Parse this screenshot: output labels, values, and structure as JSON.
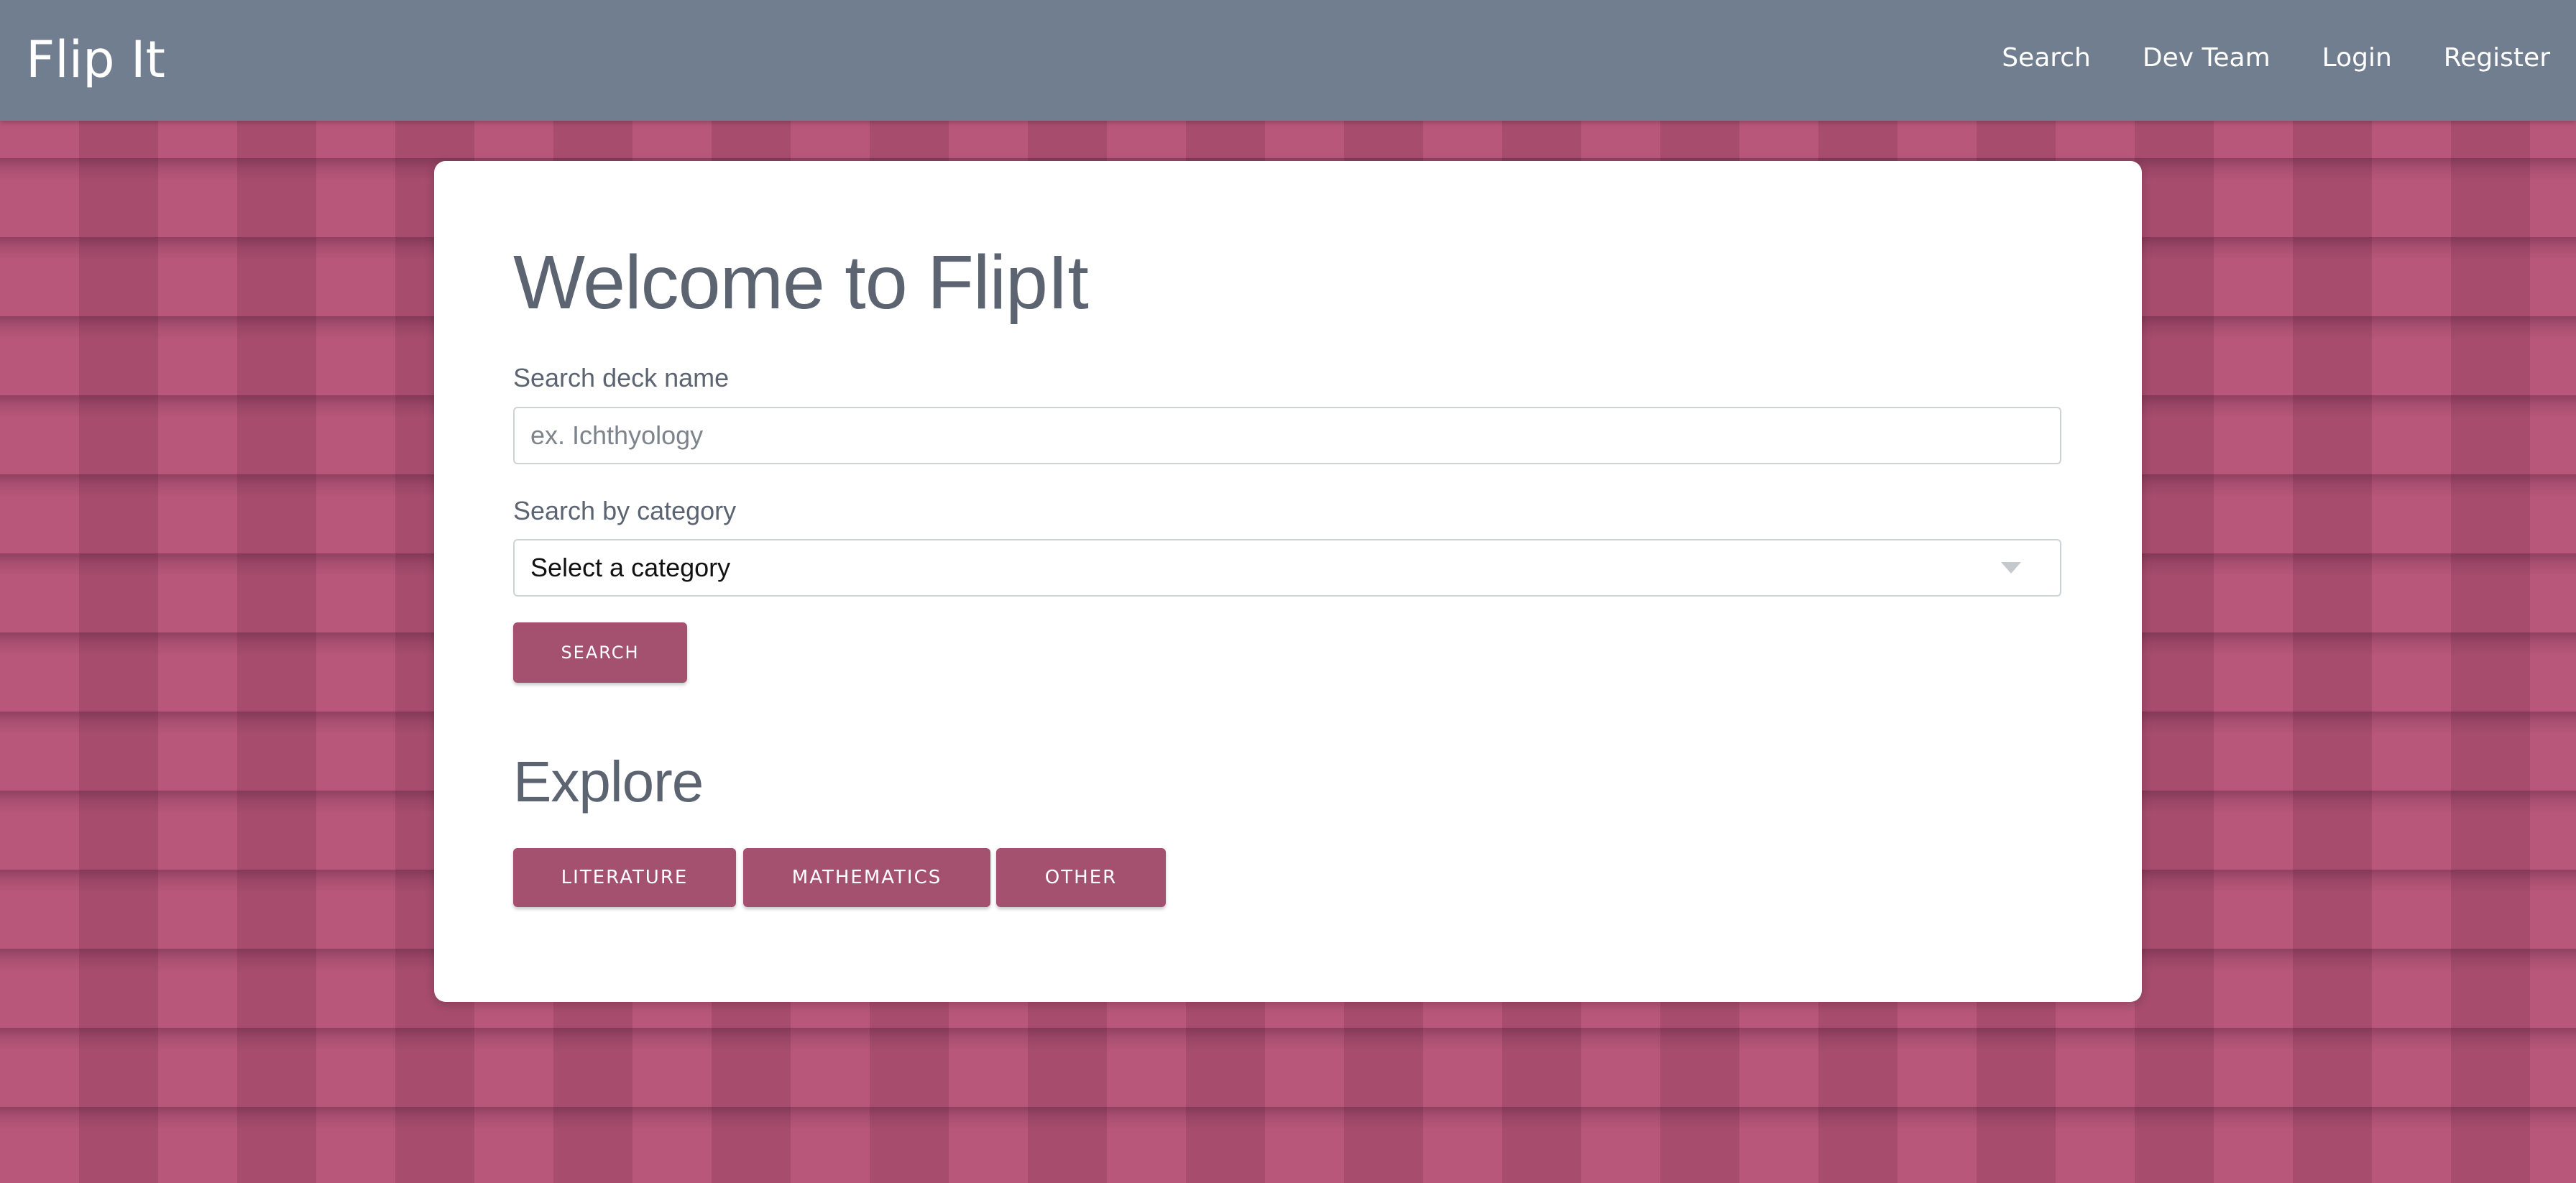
{
  "app": {
    "brand": "Flip It"
  },
  "nav": {
    "items": [
      "Search",
      "Dev Team",
      "Login",
      "Register"
    ]
  },
  "main": {
    "title": "Welcome to FlipIt",
    "search_deck_label": "Search deck name",
    "search_deck_placeholder": "ex. Ichthyology",
    "search_deck_value": "",
    "category_label": "Search by category",
    "category_selected": "Select a category",
    "search_button": "Search",
    "explore_title": "Explore",
    "explore_buttons": [
      "Literature",
      "Mathematics",
      "Other"
    ]
  },
  "colors": {
    "navbar": "#707e8f",
    "accent": "#a4506f",
    "background": "#b8577a",
    "heading_text": "#5b6470"
  }
}
